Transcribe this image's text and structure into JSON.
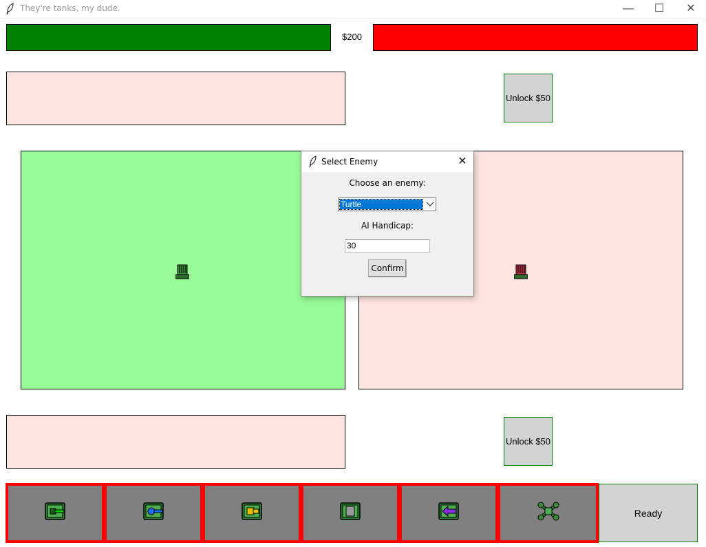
{
  "window": {
    "title": "They're tanks, my dude.",
    "minimize": "—",
    "maximize": "☐",
    "close": "✕"
  },
  "hud": {
    "money": "$200",
    "player_health_color": "#008000",
    "enemy_health_color": "#ff0000"
  },
  "slots": {
    "unlock_top": "Unlock $50",
    "unlock_bottom": "Unlock $50"
  },
  "field": {
    "player_color": "#98fb98",
    "enemy_color": "#ffe4e1"
  },
  "units": [
    {
      "icon": "green-cannon-tank-icon",
      "accent": "#00cc00"
    },
    {
      "icon": "blue-cannon-tank-icon",
      "accent": "#1e6fff"
    },
    {
      "icon": "yellow-cannon-tank-icon",
      "accent": "#e8c400"
    },
    {
      "icon": "gray-armored-tank-icon",
      "accent": "#9a9a9a"
    },
    {
      "icon": "purple-arrow-tank-icon",
      "accent": "#8a2be2"
    },
    {
      "icon": "cross-drone-tank-icon",
      "accent": "#2e8b2e"
    }
  ],
  "ready_label": "Ready",
  "dialog": {
    "title": "Select Enemy",
    "close": "✕",
    "choose_label": "Choose an enemy:",
    "enemy_selected": "Turtle",
    "handicap_label": "AI Handicap:",
    "handicap_value": "30",
    "confirm_label": "Confirm"
  }
}
